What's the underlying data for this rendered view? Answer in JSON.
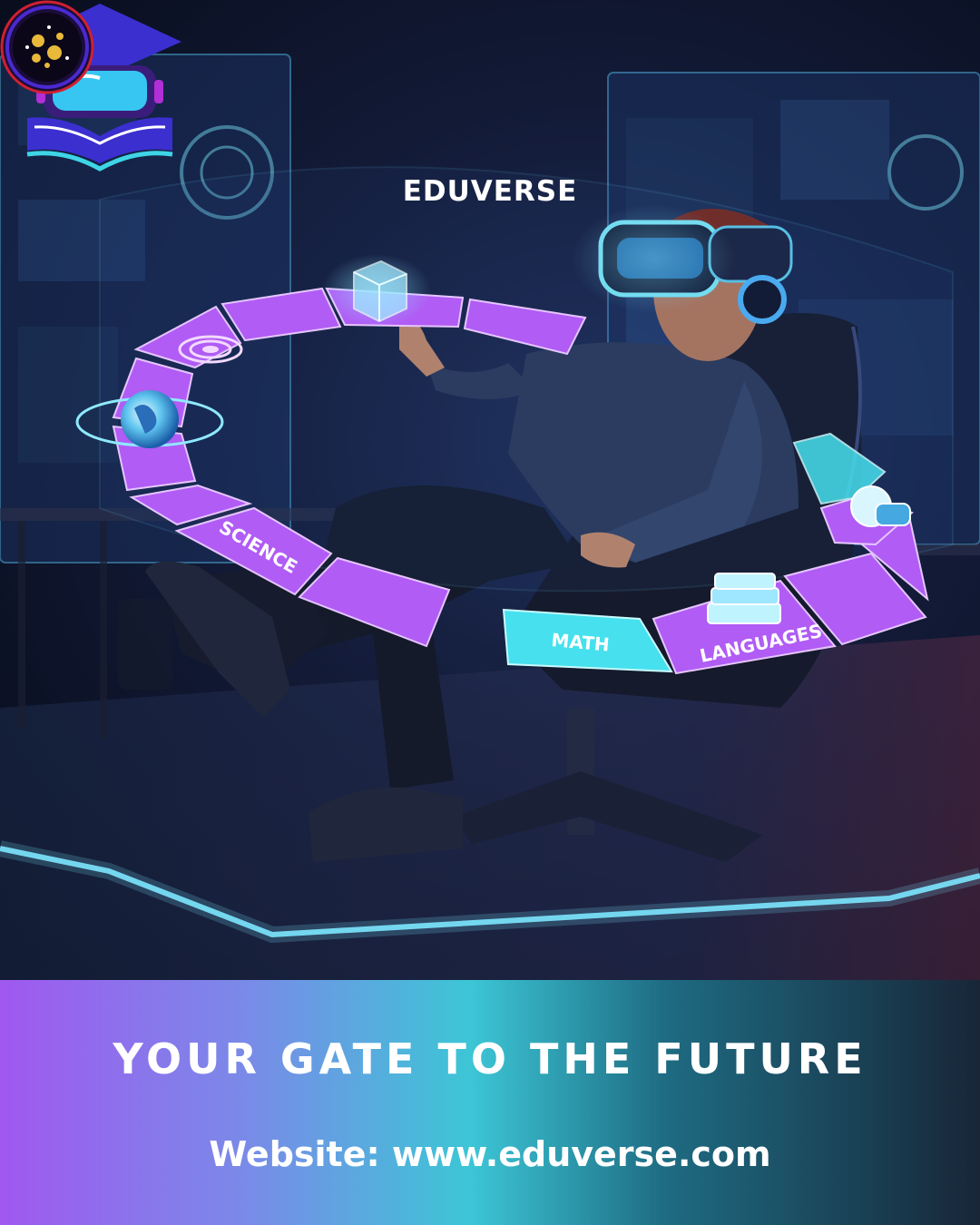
{
  "brand": {
    "name": "EDUVERSE"
  },
  "ring": {
    "labels": {
      "science": "SCIENCE",
      "math": "MATH",
      "languages": "LANGUAGES"
    }
  },
  "icons": [
    "graduation-cap-icon",
    "vr-headset-icon",
    "open-book-icon",
    "globe-icon",
    "cube-icon",
    "books-stack-icon",
    "chat-globe-icon",
    "target-rings-icon",
    "galaxy-badge-icon"
  ],
  "footer": {
    "tagline": "YOUR GATE TO THE FUTURE",
    "website": "Website: www.eduverse.com"
  },
  "colors": {
    "accent_purple": "#b05cf5",
    "accent_cyan": "#46e0ee",
    "footer_gradient_start": "#a058f0",
    "footer_gradient_end": "#182638"
  }
}
